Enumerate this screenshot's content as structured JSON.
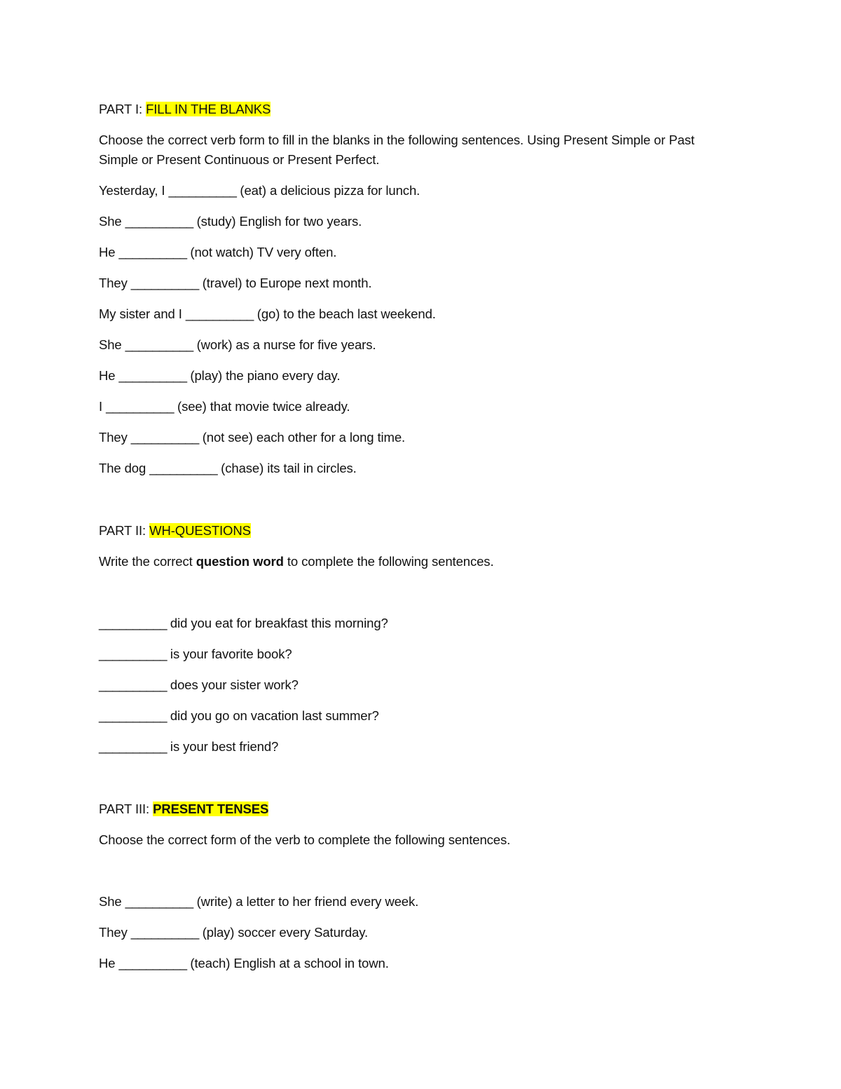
{
  "highlight_color": "#ffff00",
  "part1": {
    "prefix": "PART I: ",
    "title": "FILL IN THE BLANKS",
    "instruction_line1": "Choose the correct verb form to fill in the blanks in the following sentences. Using Present Simple or Past",
    "instruction_line2": "Simple or Present Continuous or Present Perfect.",
    "blank": "__________",
    "items": [
      {
        "before": "Yesterday, I ",
        "after": " (eat) a delicious pizza for lunch."
      },
      {
        "before": "She ",
        "after": " (study) English for two years."
      },
      {
        "before": "He ",
        "after": " (not watch) TV very often."
      },
      {
        "before": "They ",
        "after": " (travel) to Europe next month."
      },
      {
        "before": "My sister and I ",
        "after": " (go) to the beach last weekend."
      },
      {
        "before": "She ",
        "after": " (work) as a nurse for five years."
      },
      {
        "before": "He ",
        "after": " (play) the piano every day."
      },
      {
        "before": "I ",
        "after": " (see) that movie twice already."
      },
      {
        "before": "They ",
        "after": " (not see) each other for a long time."
      },
      {
        "before": "The dog ",
        "after": " (chase) its tail in circles."
      }
    ]
  },
  "part2": {
    "prefix": "PART II: ",
    "title": "WH-QUESTIONS",
    "instruction_before": "Write the correct ",
    "instruction_bold": "question word",
    "instruction_after": " to complete the following sentences.",
    "blank": "__________",
    "items": [
      {
        "after": " did you eat for breakfast this morning?"
      },
      {
        "after": " is your favorite book?"
      },
      {
        "after": " does your sister work?"
      },
      {
        "after": " did you go on vacation last summer?"
      },
      {
        "after": " is your best friend?"
      }
    ]
  },
  "part3": {
    "prefix": "PART III: ",
    "title": "PRESENT TENSES",
    "instruction": "Choose the correct form of the verb to complete the following sentences.",
    "blank": "__________",
    "items": [
      {
        "before": "She ",
        "after": " (write) a letter to her friend every week."
      },
      {
        "before": "They ",
        "after": " (play) soccer every Saturday."
      },
      {
        "before": "He ",
        "after": " (teach) English at a school in town."
      }
    ]
  }
}
